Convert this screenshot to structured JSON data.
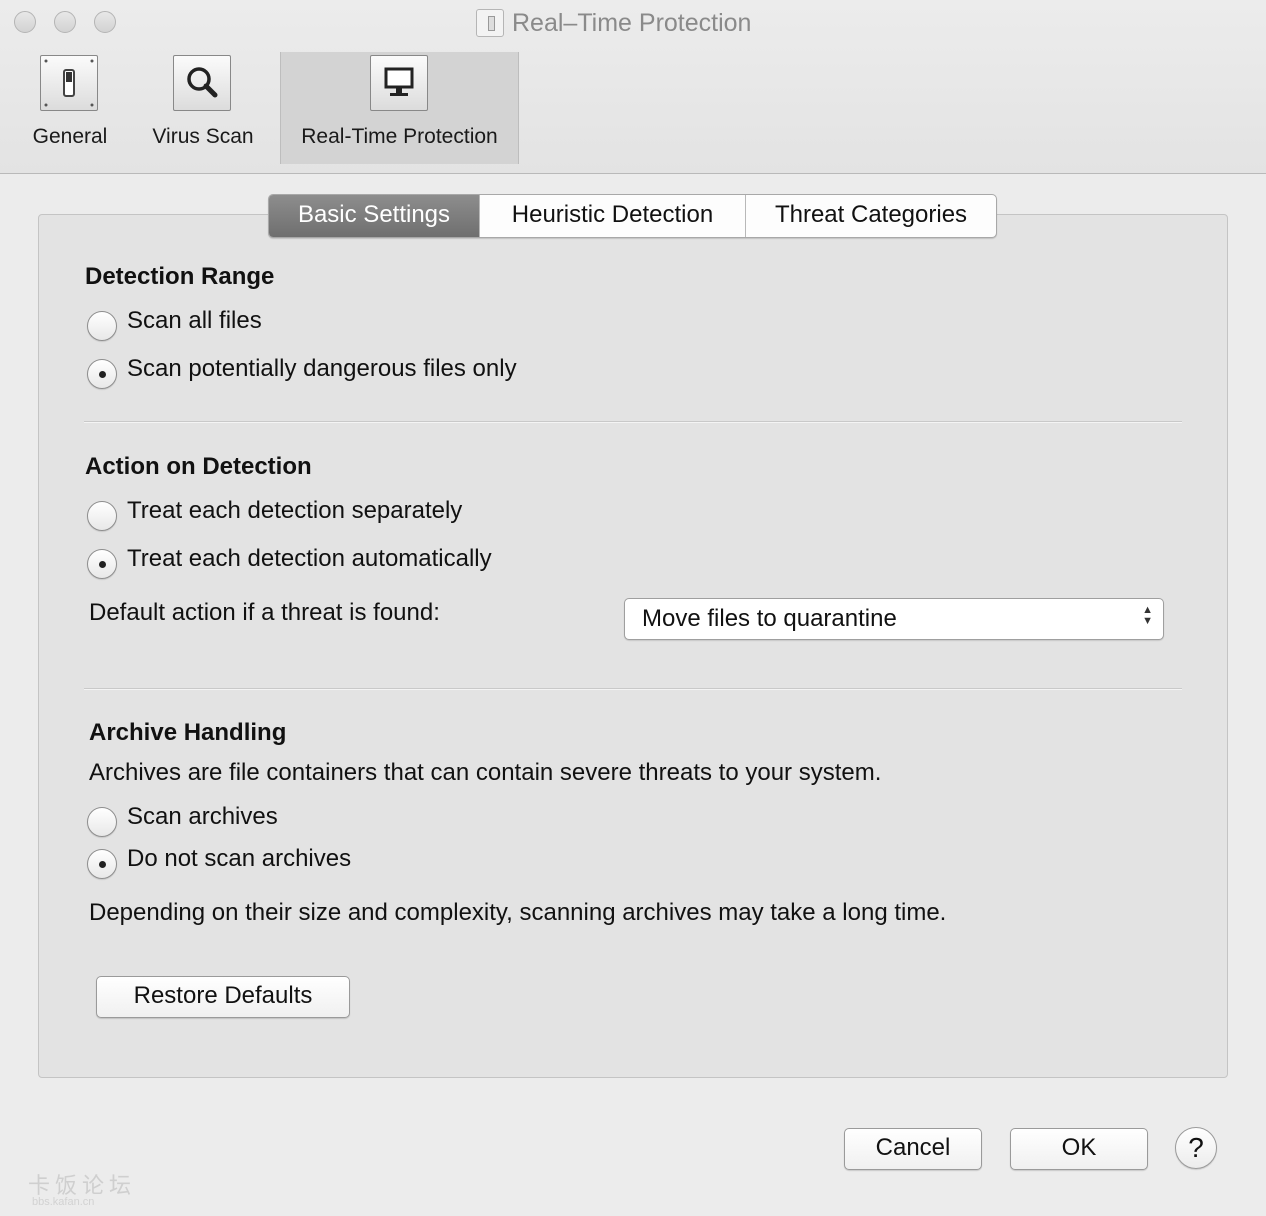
{
  "window": {
    "title": "Real–Time Protection"
  },
  "toolbar": {
    "items": [
      {
        "label": "General",
        "icon": "switch-icon"
      },
      {
        "label": "Virus Scan",
        "icon": "magnifier-icon"
      },
      {
        "label": "Real-Time Protection",
        "icon": "monitor-icon",
        "active": true
      }
    ]
  },
  "tabs": [
    {
      "label": "Basic Settings",
      "selected": true
    },
    {
      "label": "Heuristic Detection"
    },
    {
      "label": "Threat Categories"
    }
  ],
  "detection_range": {
    "heading": "Detection Range",
    "options": [
      {
        "label": "Scan all files",
        "selected": false
      },
      {
        "label": "Scan potentially dangerous files only",
        "selected": true
      }
    ]
  },
  "action_on_detection": {
    "heading": "Action on Detection",
    "options": [
      {
        "label": "Treat each detection separately",
        "selected": false
      },
      {
        "label": "Treat each detection automatically",
        "selected": true
      }
    ],
    "default_action_label": "Default action if a threat is found:",
    "default_action_value": "Move files to quarantine"
  },
  "archive_handling": {
    "heading": "Archive Handling",
    "description": "Archives are file containers that can contain severe threats to your system.",
    "options": [
      {
        "label": "Scan archives",
        "selected": false
      },
      {
        "label": "Do not scan archives",
        "selected": true
      }
    ],
    "note": "Depending on their size and complexity, scanning archives may take a long time."
  },
  "buttons": {
    "restore_defaults": "Restore Defaults",
    "cancel": "Cancel",
    "ok": "OK",
    "help": "?"
  },
  "watermark": {
    "text": "卡饭论坛",
    "url": "bbs.kafan.cn"
  }
}
